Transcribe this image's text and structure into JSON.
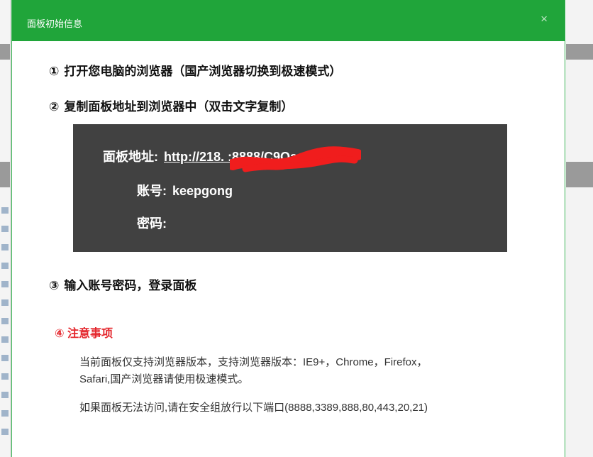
{
  "dialog": {
    "title": "面板初始信息",
    "close_glyph": "×"
  },
  "steps": [
    {
      "num": "①",
      "text": "打开您电脑的浏览器（国产浏览器切换到极速模式）"
    },
    {
      "num": "②",
      "text": "复制面板地址到浏览器中（双击文字复制）"
    },
    {
      "num": "③",
      "text": "输入账号密码，登录面板"
    }
  ],
  "panel": {
    "address_label": "面板地址:",
    "address_value": "http://218.             :8888/C9QarSs1",
    "account_label": "账号:",
    "account_value": "keepgong",
    "password_label": "密码:",
    "password_value": ""
  },
  "notice": {
    "title": "④ 注意事项",
    "line1": "当前面板仅支持浏览器版本，支持浏览器版本：IE9+，Chrome，Firefox，",
    "line2": "Safari,国产浏览器请使用极速模式。",
    "line3": "如果面板无法访问,请在安全组放行以下端口(8888,3389,888,80,443,20,21)"
  },
  "colors": {
    "titlebar": "#20a53a",
    "panel_bg": "#414141",
    "warning": "#e4262c",
    "redaction": "#f01d1d"
  }
}
